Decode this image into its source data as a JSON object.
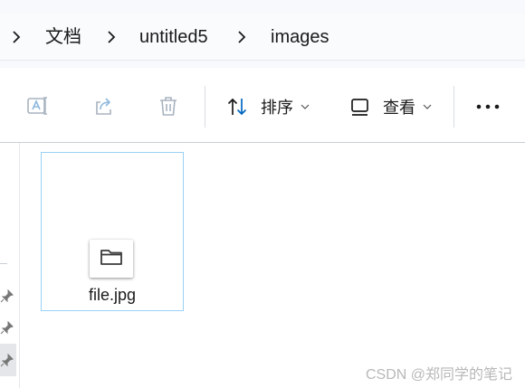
{
  "breadcrumb": {
    "items": [
      "文档",
      "untitled5",
      "images"
    ]
  },
  "toolbar": {
    "rename_icon": "rename-icon",
    "share_icon": "share-icon",
    "delete_icon": "trash-icon",
    "sort_label": "排序",
    "view_label": "查看",
    "more_icon": "more-icon"
  },
  "files": [
    {
      "name": "file.jpg",
      "icon": "folder-icon",
      "selected": true
    }
  ],
  "watermark": "CSDN @郑同学的笔记",
  "colors": {
    "accent": "#0067c0",
    "selection_border": "#99d1f4",
    "disabled_icon": "#a8b3bf"
  }
}
